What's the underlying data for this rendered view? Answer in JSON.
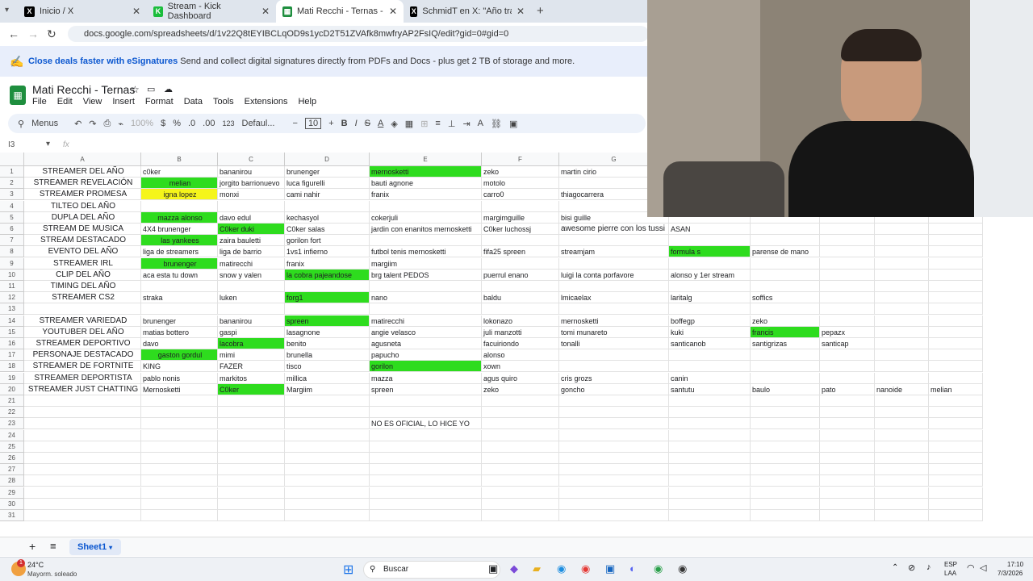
{
  "browser": {
    "tabs": [
      {
        "title": "Inicio / X",
        "icon": "x-icon"
      },
      {
        "title": "Stream - Kick Dashboard",
        "icon": "kick-icon"
      },
      {
        "title": "Mati Recchi - Ternas - Google S",
        "icon": "sheets-icon",
        "active": true
      },
      {
        "title": "SchmidT en X: \"Año tranquilo e",
        "icon": "x-icon"
      }
    ],
    "url": "docs.google.com/spreadsheets/d/1v22Q8tEYIBCLqOD9s1ycD2T51ZVAfk8mwfryAP2FsIQ/edit?gid=0#gid=0"
  },
  "banner": {
    "bold": "Close deals faster with eSignatures",
    "text": "Send and collect digital signatures directly from PDFs and Docs - plus get 2 TB of storage and more."
  },
  "doc": {
    "title": "Mati Recchi - Ternas",
    "menu": [
      "File",
      "Edit",
      "View",
      "Insert",
      "Format",
      "Data",
      "Tools",
      "Extensions",
      "Help"
    ]
  },
  "toolbar": {
    "search": "Menus",
    "zoom": "100%",
    "currency": "$",
    "percent": "%",
    "dec_decrease": ".0",
    "dec_increase": ".00",
    "number_format": "123",
    "font": "Defaul...",
    "font_size": "10"
  },
  "formula": {
    "cell_ref": "I3",
    "fx": "fx"
  },
  "columns": [
    "A",
    "B",
    "C",
    "D",
    "E",
    "F",
    "G"
  ],
  "rows": [
    {
      "n": "1",
      "cells": [
        "STREAMER DEL AÑO",
        "c0ker",
        "bananirou",
        "brunenger",
        "mernosketti",
        "zeko",
        "martin cirio",
        "",
        "",
        "",
        "",
        ""
      ],
      "hl": {
        "4": "green"
      }
    },
    {
      "n": "2",
      "cells": [
        "STREAMER REVELACIÓN",
        "melian",
        "jorgito barrionuevo",
        "luca figurelli",
        "bauti agnone",
        "motolo",
        "",
        "",
        "",
        "",
        "",
        ""
      ],
      "hl": {
        "1": "green"
      }
    },
    {
      "n": "3",
      "cells": [
        "STREAMER PROMESA",
        "igna lopez",
        "monxi",
        "cami nahir",
        "franix",
        "carro0",
        "thiagocarrera",
        "",
        "",
        "",
        "",
        ""
      ],
      "hl": {
        "1": "yellow"
      }
    },
    {
      "n": "4",
      "cells": [
        "TILTEO DEL AÑO",
        "",
        "",
        "",
        "",
        "",
        "",
        "",
        "",
        "",
        "",
        ""
      ],
      "hl": {}
    },
    {
      "n": "5",
      "cells": [
        "DUPLA DEL AÑO",
        "mazza alonso",
        "davo edul",
        "kechasyol",
        "cokerjuli",
        "margimguille",
        "bisi guille",
        "",
        "",
        "",
        "",
        ""
      ],
      "hl": {
        "1": "green"
      }
    },
    {
      "n": "6",
      "cells": [
        "STREAM DE MUSICA",
        "4X4 brunenger",
        "C0ker duki",
        "C0ker salas",
        "jardin con enanitos mernosketti",
        "C0ker luchossj",
        "awesome pierre con los tussi",
        "ASAN",
        "",
        "",
        "",
        ""
      ],
      "hl": {
        "2": "green"
      }
    },
    {
      "n": "7",
      "cells": [
        "STREAM DESTACADO",
        "las yankees",
        "zaira bauletti",
        "gorilon fort",
        "",
        "",
        "",
        "",
        "",
        "",
        "",
        ""
      ],
      "hl": {
        "1": "green"
      }
    },
    {
      "n": "8",
      "cells": [
        "EVENTO DEL AÑO",
        "liga de streamers",
        "liga de barrio",
        "1vs1 infierno",
        "futbol tenis mernosketti",
        "fifa25 spreen",
        "streamjam",
        "formula s",
        "parense de mano",
        "",
        "",
        ""
      ],
      "hl": {
        "7": "green"
      }
    },
    {
      "n": "9",
      "cells": [
        "STREAMER IRL",
        "brunenger",
        "matirecchi",
        "franix",
        "margiim",
        "",
        "",
        "",
        "",
        "",
        "",
        ""
      ],
      "hl": {
        "1": "green"
      }
    },
    {
      "n": "10",
      "cells": [
        "CLIP DEL AÑO",
        "aca esta tu down",
        "snow y valen",
        "la cobra pajeandose",
        "brg talent PEDOS",
        "puerrul enano",
        "luigi la conta porfavore",
        "alonso y 1er stream",
        "",
        "",
        "",
        ""
      ],
      "hl": {
        "3": "green"
      }
    },
    {
      "n": "11",
      "cells": [
        "TIMING DEL AÑO",
        "",
        "",
        "",
        "",
        "",
        "",
        "",
        "",
        "",
        "",
        ""
      ],
      "hl": {}
    },
    {
      "n": "12",
      "cells": [
        "STREAMER CS2",
        "straka",
        "luken",
        "forg1",
        "nano",
        "baldu",
        "lmicaelax",
        "laritalg",
        "soffics",
        "",
        "",
        ""
      ],
      "hl": {
        "3": "green"
      }
    },
    {
      "n": "13",
      "cells": [
        "",
        "",
        "",
        "",
        "",
        "",
        "",
        "",
        "",
        "",
        "",
        ""
      ],
      "hl": {}
    },
    {
      "n": "14",
      "cells": [
        "STREAMER VARIEDAD",
        "brunenger",
        "bananirou",
        "spreen",
        "matirecchi",
        "lokonazo",
        "mernosketti",
        "boffegp",
        "zeko",
        "",
        "",
        ""
      ],
      "hl": {
        "3": "green"
      }
    },
    {
      "n": "15",
      "cells": [
        "YOUTUBER DEL AÑO",
        "matias bottero",
        "gaspi",
        "lasagnone",
        "angie velasco",
        "juli manzotti",
        "tomi munareto",
        "kuki",
        "francis",
        "pepazx",
        "",
        ""
      ],
      "hl": {
        "8": "green"
      }
    },
    {
      "n": "16",
      "cells": [
        "STREAMER DEPORTIVO",
        "davo",
        "lacobra",
        "benito",
        "agusneta",
        "facuiriondo",
        "tonalli",
        "santicanob",
        "santigrizas",
        "santicap",
        "",
        ""
      ],
      "hl": {
        "2": "green"
      }
    },
    {
      "n": "17",
      "cells": [
        "PERSONAJE DESTACADO",
        "gaston gordul",
        "mimi",
        "brunella",
        "papucho",
        "alonso",
        "",
        "",
        "",
        "",
        "",
        ""
      ],
      "hl": {
        "1": "green"
      }
    },
    {
      "n": "18",
      "cells": [
        "STREAMER DE FORTNITE",
        "KING",
        "FAZER",
        "tisco",
        "gorilon",
        "xown",
        "",
        "",
        "",
        "",
        "",
        ""
      ],
      "hl": {
        "4": "green"
      }
    },
    {
      "n": "19",
      "cells": [
        "STREAMER DEPORTISTA",
        "pablo nonis",
        "markitos",
        "millica",
        "mazza",
        "agus quiro",
        "cris grozs",
        "canin",
        "",
        "",
        "",
        ""
      ],
      "hl": {}
    },
    {
      "n": "20",
      "cells": [
        "STREAMER JUST CHATTING",
        "Mernosketti",
        "C0ker",
        "Margiim",
        "spreen",
        "zeko",
        "goncho",
        "santutu",
        "baulo",
        "pato",
        "nanoide",
        "melian"
      ],
      "hl": {
        "2": "green"
      }
    },
    {
      "n": "21",
      "cells": [
        "",
        "",
        "",
        "",
        "",
        "",
        "",
        "",
        "",
        "",
        "",
        ""
      ],
      "hl": {}
    },
    {
      "n": "22",
      "cells": [
        "",
        "",
        "",
        "",
        "",
        "",
        "",
        "",
        "",
        "",
        "",
        ""
      ],
      "hl": {}
    },
    {
      "n": "23",
      "cells": [
        "",
        "",
        "",
        "",
        "NO ES OFICIAL, LO HICE YO",
        "",
        "",
        "",
        "",
        "",
        "",
        ""
      ],
      "hl": {}
    },
    {
      "n": "24",
      "cells": [
        "",
        "",
        "",
        "",
        "",
        "",
        "",
        "",
        "",
        "",
        "",
        ""
      ],
      "hl": {}
    },
    {
      "n": "25",
      "cells": [
        "",
        "",
        "",
        "",
        "",
        "",
        "",
        "",
        "",
        "",
        "",
        ""
      ],
      "hl": {}
    },
    {
      "n": "26",
      "cells": [
        "",
        "",
        "",
        "",
        "",
        "",
        "",
        "",
        "",
        "",
        "",
        ""
      ],
      "hl": {}
    },
    {
      "n": "27",
      "cells": [
        "",
        "",
        "",
        "",
        "",
        "",
        "",
        "",
        "",
        "",
        "",
        ""
      ],
      "hl": {}
    },
    {
      "n": "28",
      "cells": [
        "",
        "",
        "",
        "",
        "",
        "",
        "",
        "",
        "",
        "",
        "",
        ""
      ],
      "hl": {}
    },
    {
      "n": "29",
      "cells": [
        "",
        "",
        "",
        "",
        "",
        "",
        "",
        "",
        "",
        "",
        "",
        ""
      ],
      "hl": {}
    },
    {
      "n": "30",
      "cells": [
        "",
        "",
        "",
        "",
        "",
        "",
        "",
        "",
        "",
        "",
        "",
        ""
      ],
      "hl": {}
    },
    {
      "n": "31",
      "cells": [
        "",
        "",
        "",
        "",
        "",
        "",
        "",
        "",
        "",
        "",
        "",
        ""
      ],
      "hl": {}
    }
  ],
  "sheet": {
    "tab": "Sheet1"
  },
  "taskbar": {
    "weather_temp": "24°C",
    "weather_desc": "Mayorm. soleado",
    "weather_badge": "1",
    "search": "Buscar",
    "lang1": "ESP",
    "lang2": "LAA",
    "time": "17:10",
    "date": "7/3/2026"
  },
  "colors": {
    "highlight_green": "#2edc1e",
    "highlight_yellow": "#f5f51a",
    "sheets_green": "#1e8e3e"
  }
}
